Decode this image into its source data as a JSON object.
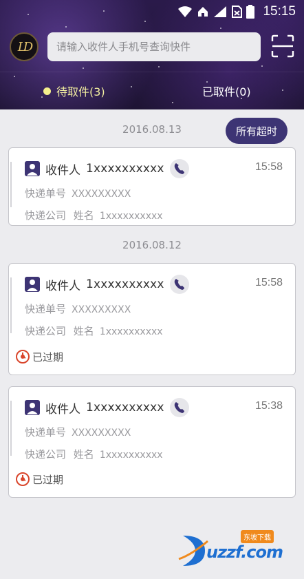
{
  "status_bar": {
    "time": "15:15"
  },
  "header": {
    "logo_text": "LD",
    "search_placeholder": "请输入收件人手机号查询快件"
  },
  "tabs": [
    {
      "label": "待取件(3)",
      "active": true
    },
    {
      "label": "已取件(0)",
      "active": false
    }
  ],
  "timeout_button": "所有超时",
  "groups": [
    {
      "date": "2016.08.13",
      "cards": [
        {
          "recipient_label": "收件人",
          "phone": "1xxxxxxxxxx",
          "time": "15:58",
          "tracking_label": "快递单号",
          "tracking_value": "XXXXXXXXX",
          "company_label": "快递公司",
          "name_label": "姓名",
          "name_value": "1xxxxxxxxxx",
          "status": ""
        }
      ]
    },
    {
      "date": "2016.08.12",
      "cards": [
        {
          "recipient_label": "收件人",
          "phone": "1xxxxxxxxxx",
          "time": "15:58",
          "tracking_label": "快递单号",
          "tracking_value": "XXXXXXXXX",
          "company_label": "快递公司",
          "name_label": "姓名",
          "name_value": "1xxxxxxxxxx",
          "status": "已过期"
        },
        {
          "recipient_label": "收件人",
          "phone": "1xxxxxxxxxx",
          "time": "15:38",
          "tracking_label": "快递单号",
          "tracking_value": "XXXXXXXXX",
          "company_label": "快递公司",
          "name_label": "姓名",
          "name_value": "1xxxxxxxxxx",
          "status": "已过期"
        }
      ]
    }
  ],
  "watermark": {
    "text": "uzzf.com",
    "badge": "东坡下载"
  },
  "colors": {
    "accent": "#3d3474",
    "header_bg": "#24173e",
    "active_tab": "#f2eea0",
    "expired_red": "#d9452b"
  }
}
